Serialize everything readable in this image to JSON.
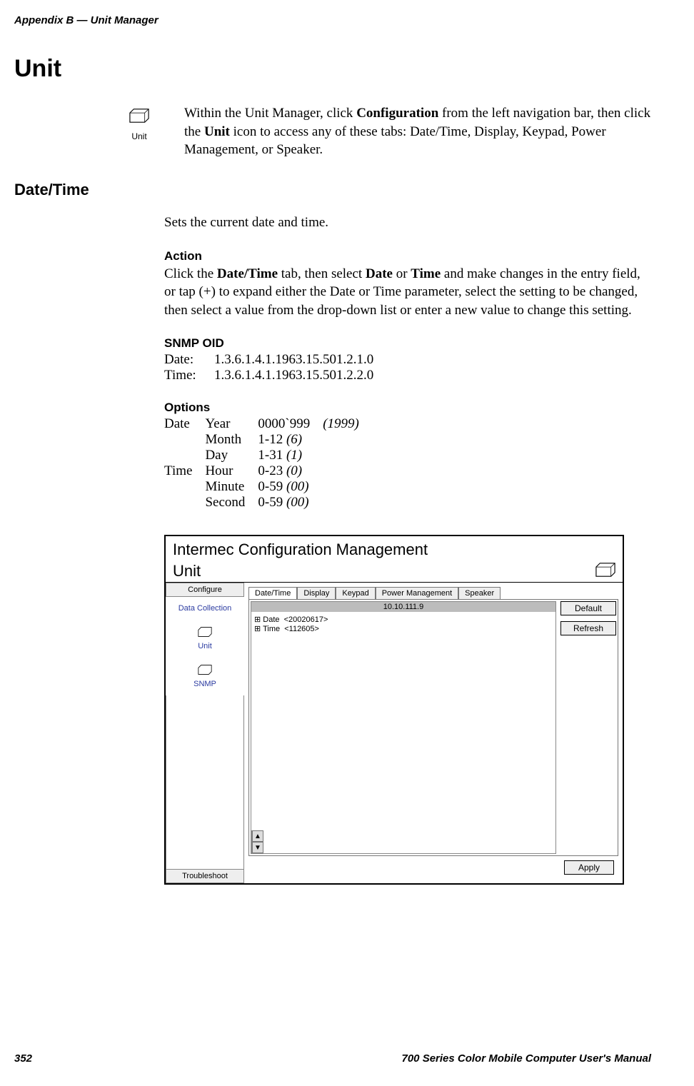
{
  "header": {
    "running_head": "Appendix B — Unit Manager"
  },
  "section": {
    "title": "Unit",
    "icon_caption": "Unit",
    "intro": "Within the Unit Manager, click Configuration from the left navigation bar, then click the Unit icon to access any of these tabs: Date/Time, Display, Keypad, Power Management, or Speaker."
  },
  "datetime": {
    "title": "Date/Time",
    "body1": "Sets the current date and time.",
    "action_heading": "Action",
    "action_body": "Click the Date/Time tab, then select Date or Time and make changes in the entry field, or tap (+) to expand either the Date or Time parameter, select the setting to be changed, then select a value from the drop-down list or enter a new value to change this setting.",
    "snmp_heading": "SNMP OID",
    "snmp_date_label": "Date:",
    "snmp_date_value": "1.3.6.1.4.1.1963.15.501.2.1.0",
    "snmp_time_label": "Time:",
    "snmp_time_value": "1.3.6.1.4.1.1963.15.501.2.2.0",
    "options_heading": "Options",
    "options": [
      {
        "group": "Date",
        "field": "Year",
        "range": "0000`999",
        "default": "(1999)"
      },
      {
        "group": "",
        "field": "Month",
        "range": "1-12",
        "default": "(6)"
      },
      {
        "group": "",
        "field": "Day",
        "range": "1-31",
        "default": "(1)"
      },
      {
        "group": "Time",
        "field": "Hour",
        "range": "0-23",
        "default": "(0)"
      },
      {
        "group": "",
        "field": "Minute",
        "range": "0-59",
        "default": "(00)"
      },
      {
        "group": "",
        "field": "Second",
        "range": "0-59",
        "default": "(00)"
      }
    ]
  },
  "screenshot": {
    "app_title": "Intermec Configuration Management",
    "panel_title": "Unit",
    "sidebar": {
      "top_tab": "Configure",
      "items": [
        {
          "label": "Data Collection"
        },
        {
          "label": "Unit"
        },
        {
          "label": "SNMP"
        }
      ],
      "bottom_tab": "Troubleshoot"
    },
    "tabs": [
      "Date/Time",
      "Display",
      "Keypad",
      "Power Management",
      "Speaker"
    ],
    "ip_header": "10.10.111.9",
    "tree": [
      "⊞ Date  <20020617>",
      "⊞ Time  <112605>"
    ],
    "buttons": {
      "default": "Default",
      "refresh": "Refresh",
      "apply": "Apply"
    }
  },
  "footer": {
    "page": "352",
    "doc": "700 Series Color Mobile Computer User's Manual"
  }
}
